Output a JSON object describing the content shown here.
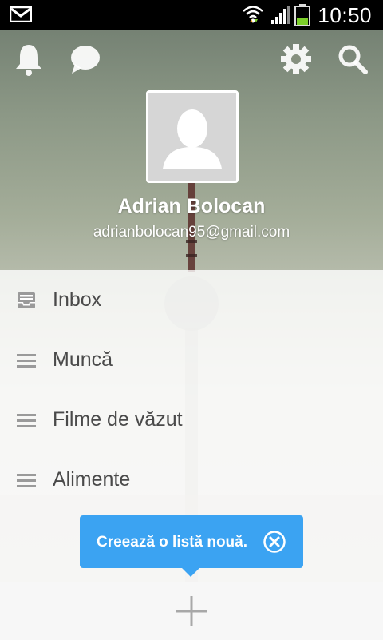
{
  "status_bar": {
    "time": "10:50",
    "icons": [
      "gmail-icon",
      "wifi-icon",
      "signal-icon",
      "battery-icon"
    ]
  },
  "header": {
    "action_icons": [
      "bell-icon",
      "chat-icon",
      "gear-icon",
      "search-icon"
    ],
    "user": {
      "name": "Adrian Bolocan",
      "email": "adrianbolocan95@gmail.com"
    }
  },
  "lists": [
    {
      "label": "Inbox",
      "icon": "inbox-icon"
    },
    {
      "label": "Muncă",
      "icon": "list-icon"
    },
    {
      "label": "Filme de văzut",
      "icon": "list-icon"
    },
    {
      "label": "Alimente",
      "icon": "list-icon"
    }
  ],
  "tooltip": {
    "text": "Creează o listă nouă.",
    "close_icon": "close-circle-icon"
  },
  "bottom_bar": {
    "add_icon": "plus-icon"
  },
  "colors": {
    "accent": "#3ba3f2",
    "list_text": "#4a4a4a",
    "list_icon": "#9a9a9a"
  }
}
